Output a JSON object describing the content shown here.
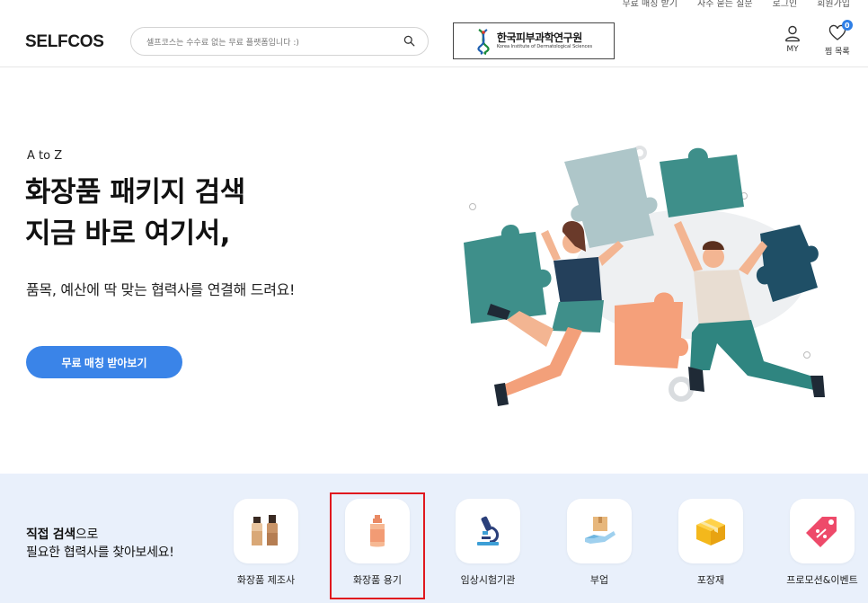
{
  "top_links": [
    "무료 매칭 받기",
    "자주 묻는 질문",
    "로그인",
    "회원가입"
  ],
  "header": {
    "logo": "SELFCOS",
    "search_placeholder": "셀프코스는 수수료 없는 무료 플랫폼입니다 :)",
    "partner_ko": "한국피부과학연구원",
    "partner_en": "Korea Institute of Dermatological Sciences",
    "my_label": "MY",
    "wishlist_label": "찜 목록",
    "wishlist_count": "0"
  },
  "hero": {
    "eyebrow": "A to Z",
    "headline_line1": "화장품 패키지 검색",
    "headline_line2": "지금 바로 여기서,",
    "subline": "품목, 예산에 딱 맞는 협력사를 연결해 드려요!",
    "cta_label": "무료 매칭 받아보기"
  },
  "direct_search": {
    "title_bold": "직접 검색",
    "title_rest": "으로",
    "title_line2": "필요한 협력사를 찾아보세요!",
    "categories": [
      {
        "label": "화장품 제조사",
        "icon": "cosmetic-bottles-icon"
      },
      {
        "label": "화장품 용기",
        "icon": "cosmetic-container-icon",
        "highlighted": true
      },
      {
        "label": "임상시험기관",
        "icon": "microscope-icon"
      },
      {
        "label": "부업",
        "icon": "box-in-hand-icon"
      },
      {
        "label": "포장재",
        "icon": "package-box-icon"
      },
      {
        "label": "프로모션&이벤트",
        "icon": "price-tag-icon"
      }
    ]
  },
  "colors": {
    "accent": "#3a84e8",
    "strip_bg": "#e9f0fb",
    "highlight": "#e0181e"
  }
}
